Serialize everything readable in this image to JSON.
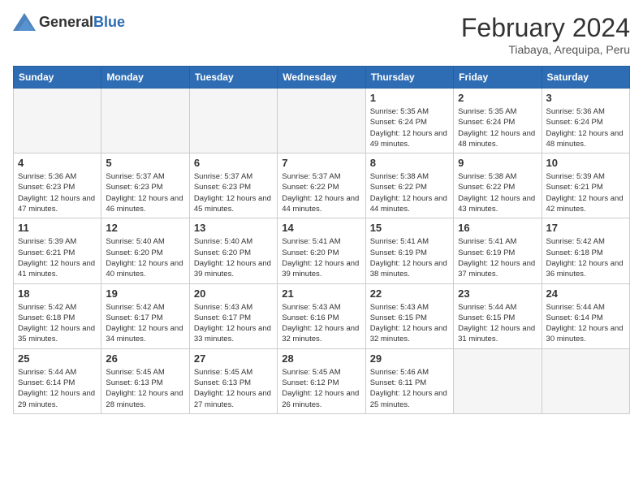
{
  "logo": {
    "general": "General",
    "blue": "Blue"
  },
  "title": "February 2024",
  "subtitle": "Tiabaya, Arequipa, Peru",
  "weekdays": [
    "Sunday",
    "Monday",
    "Tuesday",
    "Wednesday",
    "Thursday",
    "Friday",
    "Saturday"
  ],
  "weeks": [
    [
      {
        "day": "",
        "info": ""
      },
      {
        "day": "",
        "info": ""
      },
      {
        "day": "",
        "info": ""
      },
      {
        "day": "",
        "info": ""
      },
      {
        "day": "1",
        "info": "Sunrise: 5:35 AM\nSunset: 6:24 PM\nDaylight: 12 hours and 49 minutes."
      },
      {
        "day": "2",
        "info": "Sunrise: 5:35 AM\nSunset: 6:24 PM\nDaylight: 12 hours and 48 minutes."
      },
      {
        "day": "3",
        "info": "Sunrise: 5:36 AM\nSunset: 6:24 PM\nDaylight: 12 hours and 48 minutes."
      }
    ],
    [
      {
        "day": "4",
        "info": "Sunrise: 5:36 AM\nSunset: 6:23 PM\nDaylight: 12 hours and 47 minutes."
      },
      {
        "day": "5",
        "info": "Sunrise: 5:37 AM\nSunset: 6:23 PM\nDaylight: 12 hours and 46 minutes."
      },
      {
        "day": "6",
        "info": "Sunrise: 5:37 AM\nSunset: 6:23 PM\nDaylight: 12 hours and 45 minutes."
      },
      {
        "day": "7",
        "info": "Sunrise: 5:37 AM\nSunset: 6:22 PM\nDaylight: 12 hours and 44 minutes."
      },
      {
        "day": "8",
        "info": "Sunrise: 5:38 AM\nSunset: 6:22 PM\nDaylight: 12 hours and 44 minutes."
      },
      {
        "day": "9",
        "info": "Sunrise: 5:38 AM\nSunset: 6:22 PM\nDaylight: 12 hours and 43 minutes."
      },
      {
        "day": "10",
        "info": "Sunrise: 5:39 AM\nSunset: 6:21 PM\nDaylight: 12 hours and 42 minutes."
      }
    ],
    [
      {
        "day": "11",
        "info": "Sunrise: 5:39 AM\nSunset: 6:21 PM\nDaylight: 12 hours and 41 minutes."
      },
      {
        "day": "12",
        "info": "Sunrise: 5:40 AM\nSunset: 6:20 PM\nDaylight: 12 hours and 40 minutes."
      },
      {
        "day": "13",
        "info": "Sunrise: 5:40 AM\nSunset: 6:20 PM\nDaylight: 12 hours and 39 minutes."
      },
      {
        "day": "14",
        "info": "Sunrise: 5:41 AM\nSunset: 6:20 PM\nDaylight: 12 hours and 39 minutes."
      },
      {
        "day": "15",
        "info": "Sunrise: 5:41 AM\nSunset: 6:19 PM\nDaylight: 12 hours and 38 minutes."
      },
      {
        "day": "16",
        "info": "Sunrise: 5:41 AM\nSunset: 6:19 PM\nDaylight: 12 hours and 37 minutes."
      },
      {
        "day": "17",
        "info": "Sunrise: 5:42 AM\nSunset: 6:18 PM\nDaylight: 12 hours and 36 minutes."
      }
    ],
    [
      {
        "day": "18",
        "info": "Sunrise: 5:42 AM\nSunset: 6:18 PM\nDaylight: 12 hours and 35 minutes."
      },
      {
        "day": "19",
        "info": "Sunrise: 5:42 AM\nSunset: 6:17 PM\nDaylight: 12 hours and 34 minutes."
      },
      {
        "day": "20",
        "info": "Sunrise: 5:43 AM\nSunset: 6:17 PM\nDaylight: 12 hours and 33 minutes."
      },
      {
        "day": "21",
        "info": "Sunrise: 5:43 AM\nSunset: 6:16 PM\nDaylight: 12 hours and 32 minutes."
      },
      {
        "day": "22",
        "info": "Sunrise: 5:43 AM\nSunset: 6:15 PM\nDaylight: 12 hours and 32 minutes."
      },
      {
        "day": "23",
        "info": "Sunrise: 5:44 AM\nSunset: 6:15 PM\nDaylight: 12 hours and 31 minutes."
      },
      {
        "day": "24",
        "info": "Sunrise: 5:44 AM\nSunset: 6:14 PM\nDaylight: 12 hours and 30 minutes."
      }
    ],
    [
      {
        "day": "25",
        "info": "Sunrise: 5:44 AM\nSunset: 6:14 PM\nDaylight: 12 hours and 29 minutes."
      },
      {
        "day": "26",
        "info": "Sunrise: 5:45 AM\nSunset: 6:13 PM\nDaylight: 12 hours and 28 minutes."
      },
      {
        "day": "27",
        "info": "Sunrise: 5:45 AM\nSunset: 6:13 PM\nDaylight: 12 hours and 27 minutes."
      },
      {
        "day": "28",
        "info": "Sunrise: 5:45 AM\nSunset: 6:12 PM\nDaylight: 12 hours and 26 minutes."
      },
      {
        "day": "29",
        "info": "Sunrise: 5:46 AM\nSunset: 6:11 PM\nDaylight: 12 hours and 25 minutes."
      },
      {
        "day": "",
        "info": ""
      },
      {
        "day": "",
        "info": ""
      }
    ]
  ]
}
